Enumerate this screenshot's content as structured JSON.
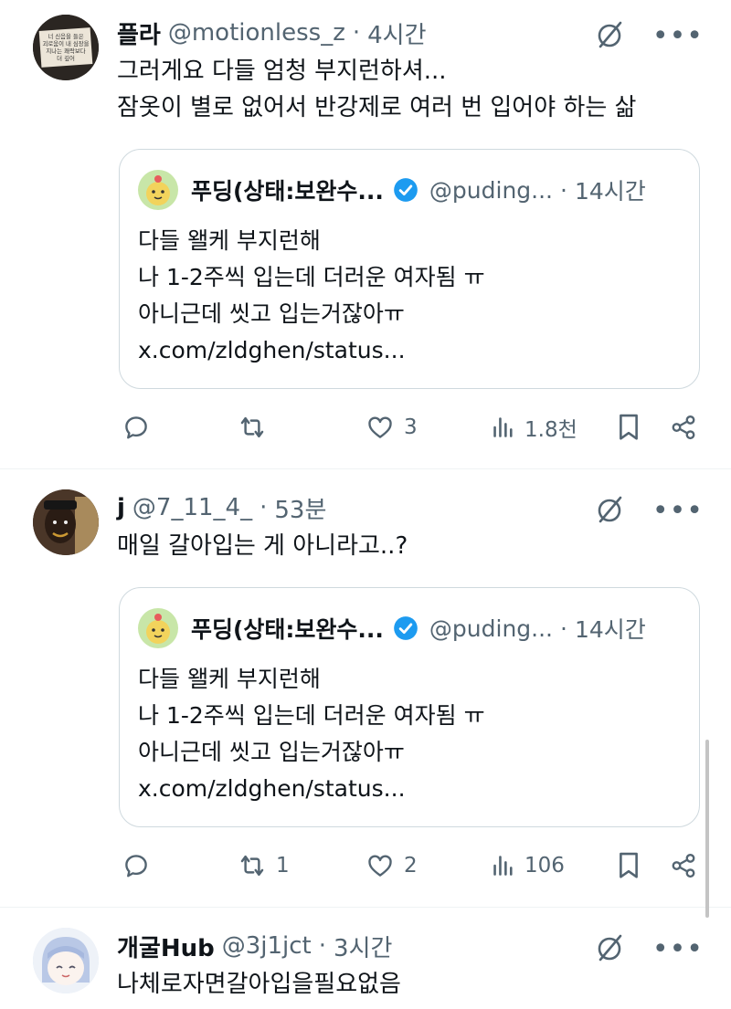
{
  "posts": [
    {
      "name": "플라",
      "handle": "@motionless_z",
      "time": "4시간",
      "lines": [
        "그러게요 다들 엄청 부지런하셔...",
        "잠옷이 별로 없어서 반강제로 여러 번 입어야 하는 삶"
      ],
      "avatar_lines": [
        "너 신음을 들은",
        "괴로움이 내 심장을",
        "지나는 쾌락보다",
        "더 깊어"
      ],
      "quote": {
        "name": "푸딩(상태:보완수...",
        "handle": "@puding...",
        "time": "14시간",
        "lines": [
          "다들 왤케 부지런해",
          "나 1-2주씩 입는데 더러운 여자됨 ㅠ",
          "아니근데 씻고 입는거잖아ㅠ",
          "x.com/zldghen/status..."
        ]
      },
      "stats": {
        "replies": "",
        "reposts": "",
        "likes": "3",
        "views": "1.8천"
      }
    },
    {
      "name": "j",
      "handle": "@7_11_4_",
      "time": "53분",
      "lines": [
        "매일 갈아입는 게 아니라고..?"
      ],
      "quote": {
        "name": "푸딩(상태:보완수...",
        "handle": "@puding...",
        "time": "14시간",
        "lines": [
          "다들 왤케 부지런해",
          "나 1-2주씩 입는데 더러운 여자됨 ㅠ",
          "아니근데 씻고 입는거잖아ㅠ",
          "x.com/zldghen/status..."
        ]
      },
      "stats": {
        "replies": "",
        "reposts": "1",
        "likes": "2",
        "views": "106"
      }
    },
    {
      "name": "개굴Hub",
      "handle": "@3j1jct",
      "time": "3시간",
      "lines": [
        "나체로자면갈아입을필요없음"
      ]
    }
  ],
  "separator": "·",
  "more_glyph": "•••",
  "colors": {
    "text": "#0f1419",
    "muted": "#536471",
    "border": "#cfd9de",
    "verified": "#1d9bf0"
  },
  "icons": [
    "grok-icon",
    "more-icon",
    "reply-icon",
    "repost-icon",
    "like-icon",
    "views-icon",
    "bookmark-icon",
    "share-icon",
    "verified-badge-icon"
  ]
}
